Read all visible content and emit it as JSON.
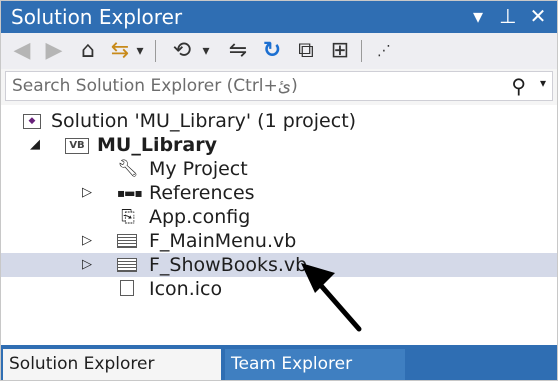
{
  "window": {
    "title": "Solution Explorer",
    "controls": {
      "dropdown": "▾",
      "pin": "⊥",
      "close": "✕"
    }
  },
  "toolbar": {
    "back_icon": "◀",
    "forward_icon": "▶",
    "home_icon": "⌂",
    "sync_icon": "⇆",
    "dropdown_icon": "▾",
    "history_icon": "⟲",
    "swap_icon": "⇋",
    "refresh_icon": "↻",
    "collapse_icon": "⧉",
    "properties_icon": "⊞",
    "overflow_icon": "⋰"
  },
  "search": {
    "placeholder": "Search Solution Explorer (Ctrl+ئ)",
    "icon": "⚲",
    "dropdown": "▾"
  },
  "tree": {
    "solution_label": "Solution 'MU_Library' (1 project)",
    "project_label": "MU_Library",
    "project_icon_text": "VB",
    "items": [
      {
        "label": "My Project",
        "icon": "wrench-icon"
      },
      {
        "label": "References",
        "icon": "references-icon"
      },
      {
        "label": "App.config",
        "icon": "config-icon"
      },
      {
        "label": "F_MainMenu.vb",
        "icon": "form-icon"
      },
      {
        "label": "F_ShowBooks.vb",
        "icon": "form-icon"
      },
      {
        "label": "Icon.ico",
        "icon": "image-file-icon"
      }
    ],
    "expand_collapsed": "▷",
    "expand_open": "◢"
  },
  "tabs": {
    "active": "Solution Explorer",
    "inactive": "Team Explorer"
  },
  "colors": {
    "accent": "#2f6eb3",
    "selection": "#d4d9e8",
    "refresh": "#1c6fd1"
  }
}
